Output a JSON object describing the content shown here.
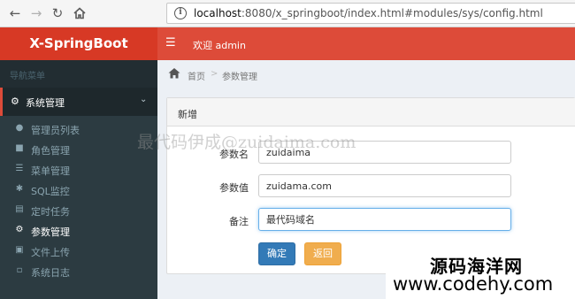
{
  "browser": {
    "url_host": "localhost",
    "url_rest": ":8080/x_springboot/index.html#modules/sys/config.html",
    "back_icon": "arrow-left-icon",
    "forward_icon": "arrow-right-icon",
    "reload_icon": "reload-icon",
    "home_icon": "home-icon"
  },
  "brand": {
    "name": "X-SpringBoot",
    "accent": "#dd4b39"
  },
  "header": {
    "welcome": "欢迎 admin"
  },
  "sidebar": {
    "title": "导航菜单",
    "group": {
      "label": "系统管理",
      "icon": "gear-icon"
    },
    "items": [
      {
        "label": "管理员列表",
        "icon": "user-icon"
      },
      {
        "label": "角色管理",
        "icon": "user-secret-icon"
      },
      {
        "label": "菜单管理",
        "icon": "list-icon"
      },
      {
        "label": "SQL监控",
        "icon": "bug-icon"
      },
      {
        "label": "定时任务",
        "icon": "tasks-icon"
      },
      {
        "label": "参数管理",
        "icon": "gear-icon"
      },
      {
        "label": "文件上传",
        "icon": "image-icon"
      },
      {
        "label": "系统日志",
        "icon": "file-icon"
      }
    ]
  },
  "breadcrumb": {
    "home": "首页",
    "separator": ">",
    "current": "参数管理"
  },
  "form": {
    "title": "新增",
    "key_label": "参数名",
    "key_value": "zuidaima",
    "value_label": "参数值",
    "value_value": "zuidama.com",
    "remark_label": "备注",
    "remark_value": "最代码域名",
    "submit_label": "确定",
    "back_label": "返回"
  },
  "watermarks": {
    "center": "最代码伊成@zuidaima.com",
    "corner_line1": "源码海洋网",
    "corner_line2": "www.codehy.com"
  }
}
